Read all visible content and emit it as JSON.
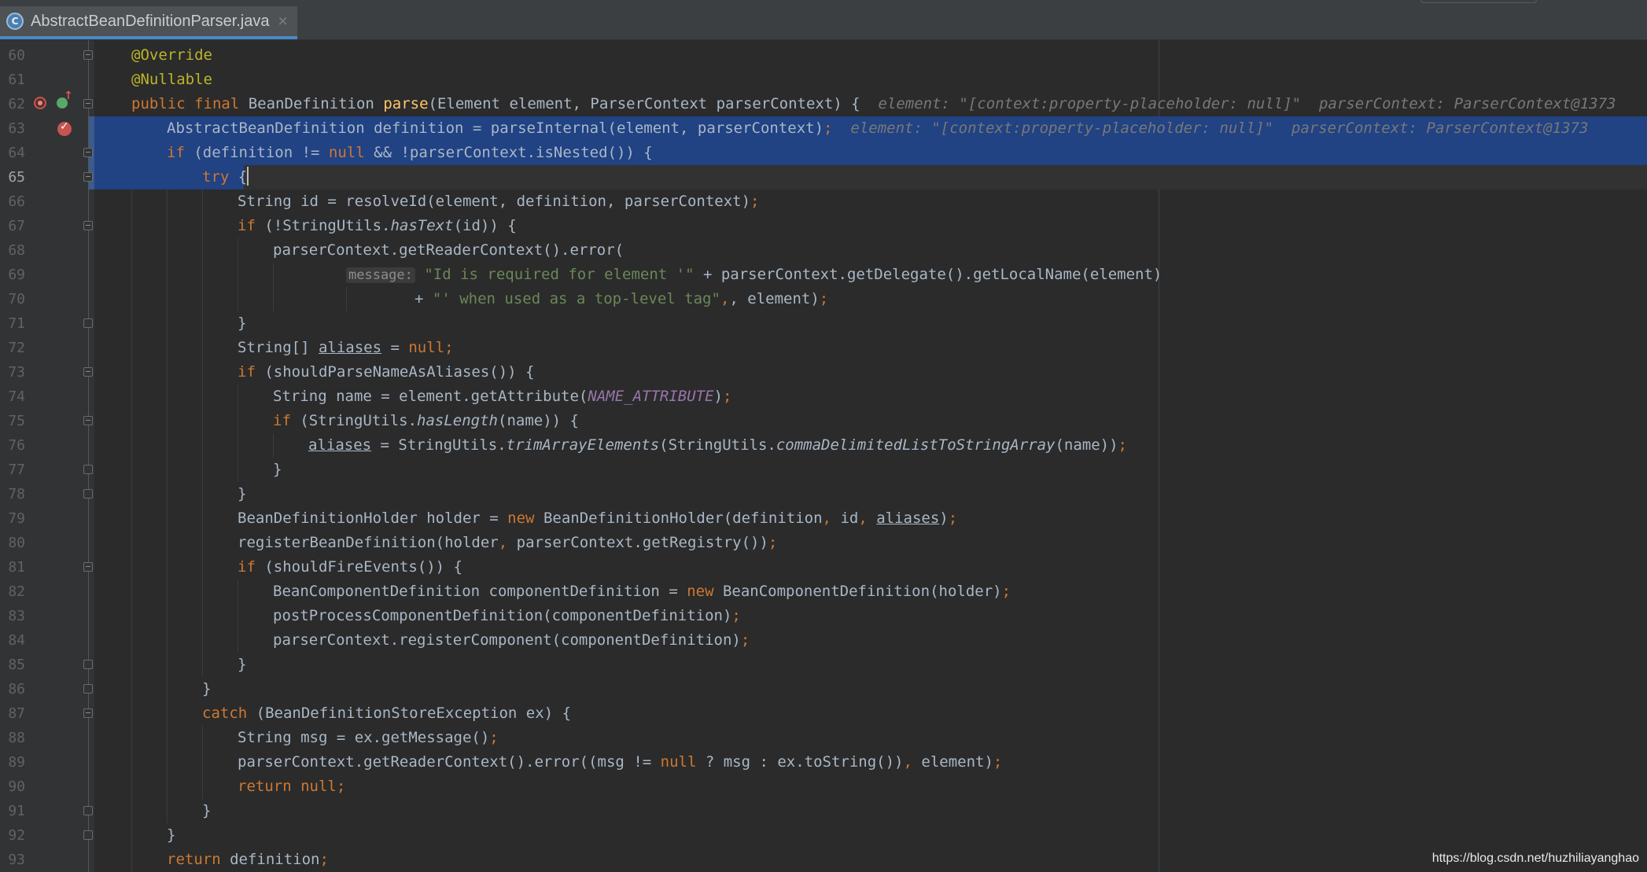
{
  "tab": {
    "icon_letter": "C",
    "title": "AbstractBeanDefinitionParser.java",
    "close": "×"
  },
  "line_numbers": [
    "60",
    "61",
    "62",
    "63",
    "64",
    "65",
    "66",
    "67",
    "68",
    "69",
    "70",
    "71",
    "72",
    "73",
    "74",
    "75",
    "76",
    "77",
    "78",
    "79",
    "80",
    "81",
    "82",
    "83",
    "84",
    "85",
    "86",
    "87",
    "88",
    "89",
    "90",
    "91",
    "92",
    "93"
  ],
  "code": {
    "l60": "@Override",
    "l61": "@Nullable",
    "l62_kw": "public final ",
    "l62_type": "BeanDefinition ",
    "l62_fn": "parse",
    "l62_rest": "(Element element, ParserContext parserContext) {",
    "l62_hint": "element: \"[context:property-placeholder: null]\"  parserContext: ParserContext@1373",
    "l63_a": "AbstractBeanDefinition definition = parseInternal(element, parserContext)",
    "l63_semi": ";",
    "l63_hint": "element: \"[context:property-placeholder: null]\"  parserContext: ParserContext@1373",
    "l64_if": "if ",
    "l64_a": "(definition != ",
    "l64_null": "null ",
    "l64_b": "&& !parserContext.isNested()) {",
    "l65_try": "try ",
    "l65_brace": "{",
    "l66": "String id = resolveId(element, definition, parserContext)",
    "l66_semi": ";",
    "l67_if": "if ",
    "l67_a": "(!StringUtils.",
    "l67_m": "hasText",
    "l67_b": "(id)) {",
    "l68": "parserContext.getReaderContext().error(",
    "l69_hint": "message:",
    "l69_str": "\"Id is required for element '\"",
    "l69_rest": " + parserContext.getDelegate().getLocalName(element)",
    "l70_plus": "+ ",
    "l70_str": "\"' when used as a top-level tag\"",
    "l70_rest": ", element)",
    "l70_semi": ";",
    "l71": "}",
    "l72_a": "String[] ",
    "l72_var": "aliases",
    "l72_b": " = ",
    "l72_null": "null",
    "l72_semi": ";",
    "l73_if": "if ",
    "l73_a": "(shouldParseNameAsAliases()) {",
    "l74_a": "String name = element.getAttribute(",
    "l74_c": "NAME_ATTRIBUTE",
    "l74_b": ")",
    "l74_semi": ";",
    "l75_if": "if ",
    "l75_a": "(StringUtils.",
    "l75_m": "hasLength",
    "l75_b": "(name)) {",
    "l76_var": "aliases",
    "l76_a": " = StringUtils.",
    "l76_m1": "trimArrayElements",
    "l76_b": "(StringUtils.",
    "l76_m2": "commaDelimitedListToStringArray",
    "l76_c": "(name))",
    "l76_semi": ";",
    "l77": "}",
    "l78": "}",
    "l79_a": "BeanDefinitionHolder holder = ",
    "l79_new": "new ",
    "l79_b": "BeanDefinitionHolder(definition",
    "l79_c1": ", ",
    "l79_id": "id",
    "l79_c2": ", ",
    "l79_var": "aliases",
    "l79_d": ")",
    "l79_semi": ";",
    "l80_a": "registerBeanDefinition(holder",
    "l80_c": ", ",
    "l80_b": "parserContext.getRegistry())",
    "l80_semi": ";",
    "l81_if": "if ",
    "l81_a": "(shouldFireEvents()) {",
    "l82_a": "BeanComponentDefinition componentDefinition = ",
    "l82_new": "new ",
    "l82_b": "BeanComponentDefinition(holder)",
    "l82_semi": ";",
    "l83": "postProcessComponentDefinition(componentDefinition)",
    "l83_semi": ";",
    "l84": "parserContext.registerComponent(componentDefinition)",
    "l84_semi": ";",
    "l85": "}",
    "l86": "}",
    "l87_catch": "catch ",
    "l87_a": "(BeanDefinitionStoreException ex) {",
    "l88": "String msg = ex.getMessage()",
    "l88_semi": ";",
    "l89_a": "parserContext.getReaderContext().error((msg != ",
    "l89_null": "null ",
    "l89_b": "? msg : ex.toString())",
    "l89_c": ", ",
    "l89_d": "element)",
    "l89_semi": ";",
    "l90_ret": "return ",
    "l90_null": "null",
    "l90_semi": ";",
    "l91": "}",
    "l92": "}",
    "l93_ret": "return ",
    "l93_a": "definition",
    "l93_semi": ";"
  },
  "watermark": "https://blog.csdn.net/huzhiliayanghao",
  "colors": {
    "background": "#2b2b2b",
    "gutter": "#313335",
    "selection": "#214283",
    "keyword": "#cc7832",
    "annotation": "#bbb529",
    "method": "#ffc66d",
    "string": "#6a8759",
    "constant": "#9876aa",
    "text": "#a9b7c6",
    "inline_hint": "#787878"
  },
  "icons": [
    "override-icon",
    "implemented-up-icon",
    "breakpoint-icon",
    "fold-icon"
  ]
}
